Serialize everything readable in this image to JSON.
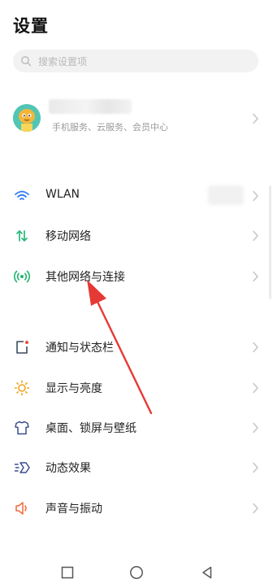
{
  "header": {
    "title": "设置"
  },
  "search": {
    "placeholder": "搜索设置项",
    "icon": "search-icon"
  },
  "account": {
    "subtitle": "手机服务、云服务、会员中心",
    "avatar_icon": "cartoon-avatar-icon"
  },
  "network_section": [
    {
      "label": "WLAN",
      "icon": "wifi-icon",
      "color": "#2f7bf6"
    },
    {
      "label": "移动网络",
      "icon": "mobile-data-icon",
      "color": "#2bb87a"
    },
    {
      "label": "其他网络与连接",
      "icon": "connection-icon",
      "color": "#21b46f"
    }
  ],
  "display_section": [
    {
      "label": "通知与状态栏",
      "icon": "notification-icon",
      "color": "#3b4a5f"
    },
    {
      "label": "显示与亮度",
      "icon": "brightness-icon",
      "color": "#f0a31c"
    },
    {
      "label": "桌面、锁屏与壁纸",
      "icon": "shirt-icon",
      "color": "#3a4d8f"
    },
    {
      "label": "动态效果",
      "icon": "dynamic-effect-icon",
      "color": "#3a4d8f"
    },
    {
      "label": "声音与振动",
      "icon": "speaker-icon",
      "color": "#f06a3a"
    }
  ],
  "navbar": {
    "back_icon": "back-triangle-icon",
    "home_icon": "home-circle-icon",
    "recents_icon": "recents-square-icon"
  },
  "annotation": {
    "arrow_color": "#e53935"
  }
}
